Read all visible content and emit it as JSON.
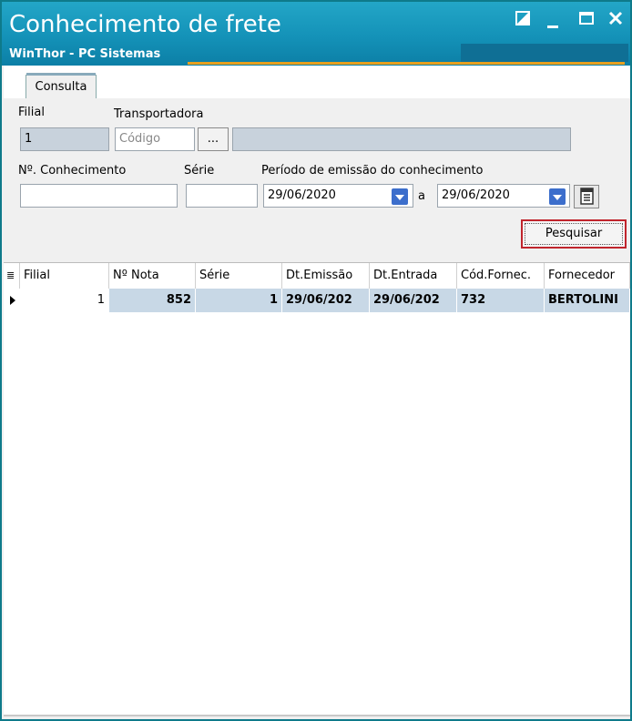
{
  "window": {
    "title": "Conhecimento de frete",
    "subtitle": "WinThor - PC Sistemas",
    "controls": [
      "restore-icon",
      "minimize-icon",
      "maximize-icon",
      "close-icon"
    ]
  },
  "tabs": [
    {
      "label": "Consulta",
      "active": true
    }
  ],
  "form": {
    "filial_label": "Filial",
    "filial_value": "1",
    "transportadora_label": "Transportadora",
    "codigo_placeholder": "Código",
    "lookup_button": "...",
    "transportadora_name": "",
    "conhecimento_label": "Nº. Conhecimento",
    "conhecimento_value": "",
    "serie_label": "Série",
    "serie_value": "",
    "periodo_label": "Período de emissão do conhecimento",
    "date_from": "29/06/2020",
    "separator": "a",
    "date_to": "29/06/2020",
    "search_button": "Pesquisar"
  },
  "grid": {
    "columns": [
      "Filial",
      "Nº Nota",
      "Série",
      "Dt.Emissão",
      "Dt.Entrada",
      "Cód.Fornec.",
      "Fornecedor"
    ],
    "rows": [
      [
        "1",
        "852",
        "1",
        "29/06/202",
        "29/06/202",
        "732",
        "BERTOLINI"
      ]
    ]
  },
  "colors": {
    "titlebar": "#1492b8",
    "accent": "#e8a020",
    "dropdown": "#3c6ecc",
    "selected_row": "#c8d8e6",
    "focus_border": "#c0242c"
  }
}
